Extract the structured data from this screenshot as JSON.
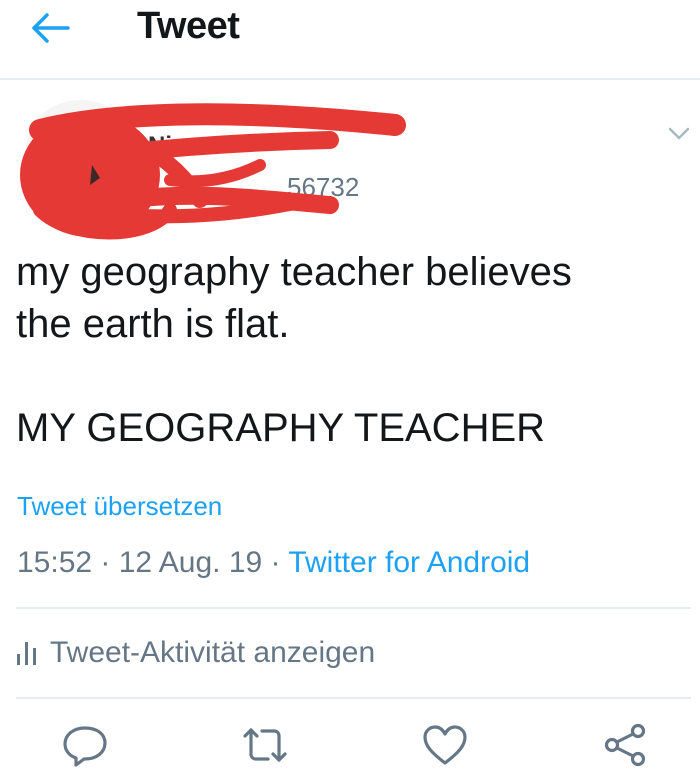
{
  "header": {
    "title": "Tweet",
    "back_icon": "arrow-left-icon"
  },
  "author": {
    "name_fragment": "Ni",
    "handle_fragment": "56732"
  },
  "tweet": {
    "text": "my geography teacher believes\nthe earth is flat.\n\nMY GEOGRAPHY TEACHER",
    "translate_label": "Tweet übersetzen",
    "time": "15:52",
    "date": "12 Aug. 19",
    "separator": " · ",
    "source": "Twitter for Android"
  },
  "activity": {
    "label": "Tweet-Aktivität anzeigen"
  },
  "actions": [
    {
      "name": "reply",
      "icon": "reply-icon"
    },
    {
      "name": "retweet",
      "icon": "retweet-icon"
    },
    {
      "name": "like",
      "icon": "heart-icon"
    },
    {
      "name": "share",
      "icon": "share-icon"
    }
  ],
  "colors": {
    "accent": "#1da1f2",
    "secondary_text": "#657786",
    "divider": "#e6ecf0",
    "redaction": "#e53935"
  }
}
